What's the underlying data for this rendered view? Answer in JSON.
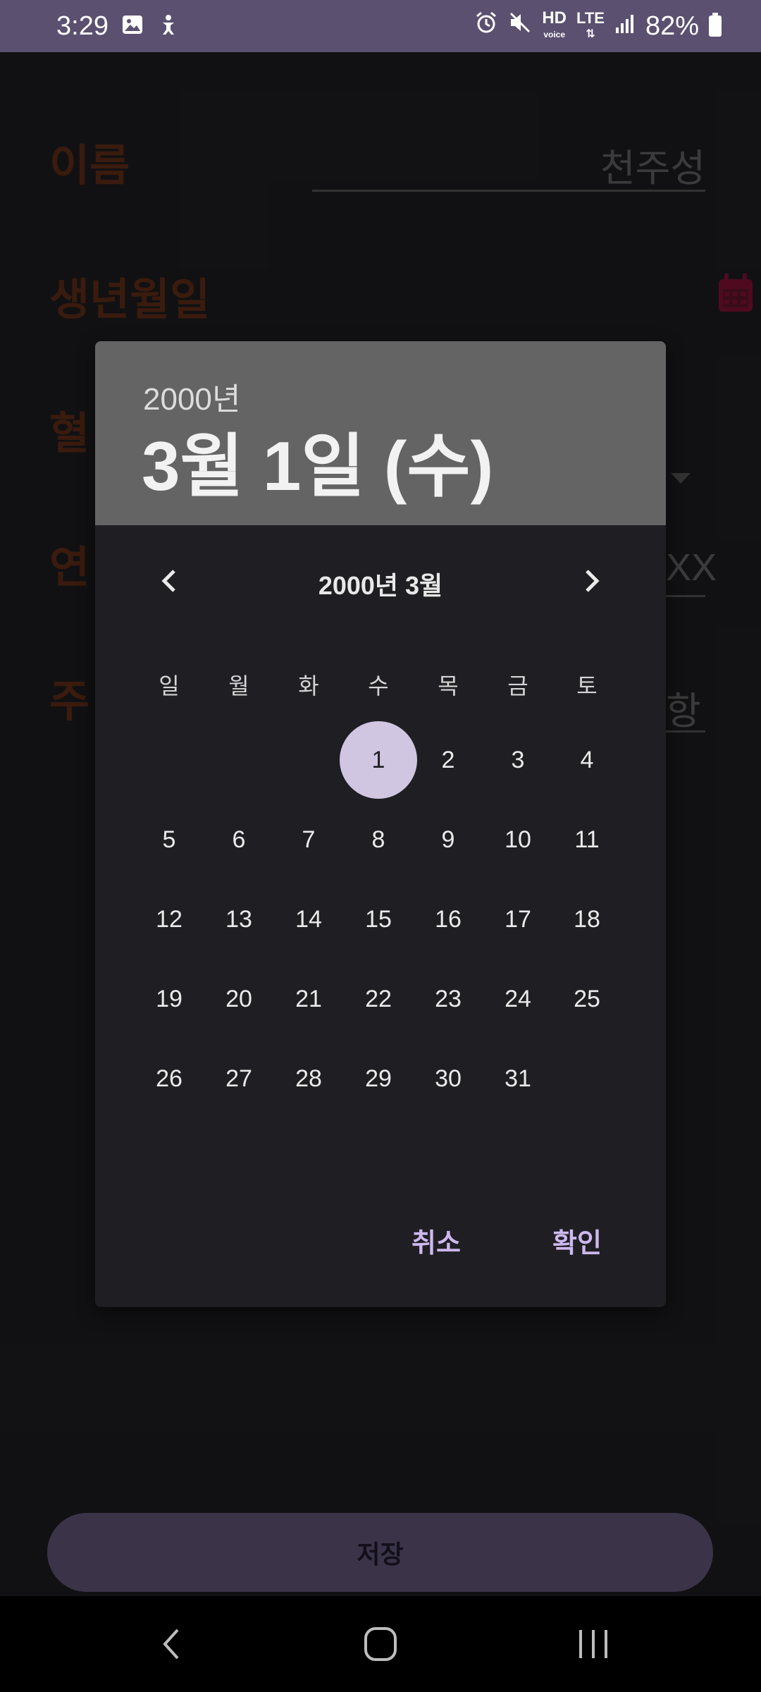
{
  "status_bar": {
    "time": "3:29",
    "battery": "82%",
    "icons": [
      "gallery-icon",
      "accessibility-icon",
      "alarm-icon",
      "mute-icon",
      "hd-voice-icon",
      "lte-icon",
      "signal-icon",
      "battery-icon"
    ],
    "hd_label": "HD",
    "voice_label": "voice",
    "lte_label": "LTE"
  },
  "form": {
    "name_label": "이름",
    "name_value": "천주성",
    "birth_label": "생년월일",
    "blood_label": "혈",
    "contact_label": "연",
    "contact_value_partial": "XX",
    "address_label": "주",
    "address_value_partial": "항",
    "save_label": "저장"
  },
  "dialog": {
    "header_year": "2000년",
    "header_date": "3월 1일 (수)",
    "month_label": "2000년 3월",
    "weekdays": [
      "일",
      "월",
      "화",
      "수",
      "목",
      "금",
      "토"
    ],
    "days": [
      "1",
      "2",
      "3",
      "4",
      "5",
      "6",
      "7",
      "8",
      "9",
      "10",
      "11",
      "12",
      "13",
      "14",
      "15",
      "16",
      "17",
      "18",
      "19",
      "20",
      "21",
      "22",
      "23",
      "24",
      "25",
      "26",
      "27",
      "28",
      "29",
      "30",
      "31"
    ],
    "first_weekday_index": 3,
    "selected_day": "1",
    "cancel_label": "취소",
    "ok_label": "확인"
  },
  "colors": {
    "accent": "#cdb8ee",
    "selected_circle": "#d0c6e2",
    "status_bar": "#5b5070",
    "header_bg": "#646464",
    "dialog_bg": "#1f1e23",
    "label_color": "#5a2a14",
    "calendar_icon": "#7a1030"
  }
}
